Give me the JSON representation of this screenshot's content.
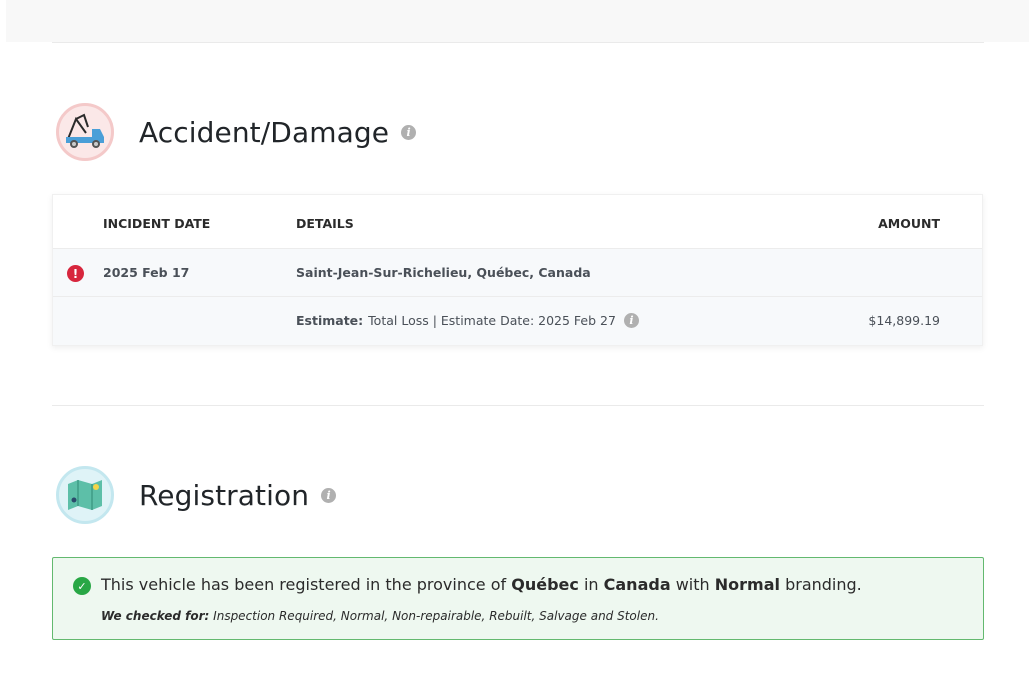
{
  "accident": {
    "title": "Accident/Damage",
    "icon": "tow-truck-icon",
    "columns": {
      "date": "INCIDENT DATE",
      "details": "DETAILS",
      "amount": "AMOUNT"
    },
    "incident": {
      "date": "2025 Feb 17",
      "location": "Saint-Jean-Sur-Richelieu, Québec, Canada",
      "estimate_label": "Estimate:",
      "estimate_text": "Total Loss | Estimate Date: 2025 Feb 27",
      "amount": "$14,899.19"
    }
  },
  "registration": {
    "title": "Registration",
    "icon": "map-icon",
    "message": {
      "prefix": "This vehicle has been registered in the province of",
      "province": "Québec",
      "in": "in",
      "country": "Canada",
      "with": "with",
      "branding": "Normal",
      "suffix": "branding."
    },
    "checked_label": "We checked for:",
    "checked_list": "Inspection Required, Normal, Non-repairable, Rebuilt, Salvage and Stolen."
  },
  "colors": {
    "alert": "#d7263d",
    "success": "#28a745",
    "success_bg": "#eef8f0"
  }
}
